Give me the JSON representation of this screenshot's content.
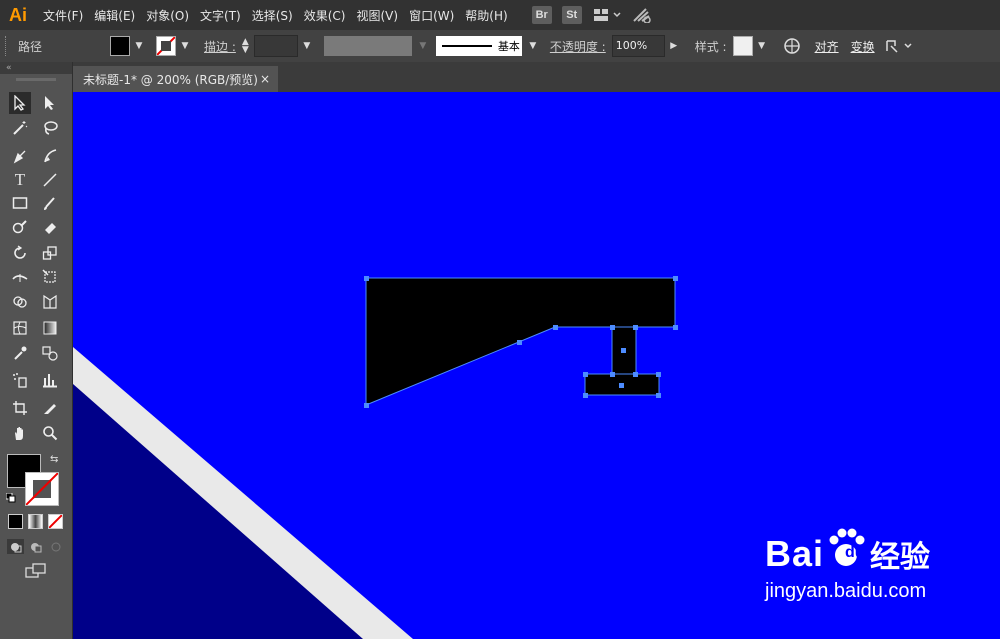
{
  "app": {
    "logo": "Ai"
  },
  "menu": [
    "文件(F)",
    "编辑(E)",
    "对象(O)",
    "文字(T)",
    "选择(S)",
    "效果(C)",
    "视图(V)",
    "窗口(W)",
    "帮助(H)"
  ],
  "badges": [
    "Br",
    "St"
  ],
  "control": {
    "type_label": "路径",
    "stroke_label": "描边 :",
    "stroke_style": "基本",
    "opacity_label": "不透明度 :",
    "opacity_value": "100%",
    "style_label": "样式 :",
    "align_label": "对齐",
    "transform_label": "变换"
  },
  "document": {
    "tab_title": "未标题-1* @ 200% (RGB/预览)",
    "close": "×"
  },
  "colors": {
    "canvas": "#0000ff",
    "dark_region": "#000089",
    "stripe": "#e9e9e9",
    "shape": "#000000",
    "selection": "#4d8cff"
  },
  "watermark": {
    "brand": "Bai",
    "brand2": "du",
    "cn": "经验",
    "url": "jingyan.baidu.com"
  }
}
